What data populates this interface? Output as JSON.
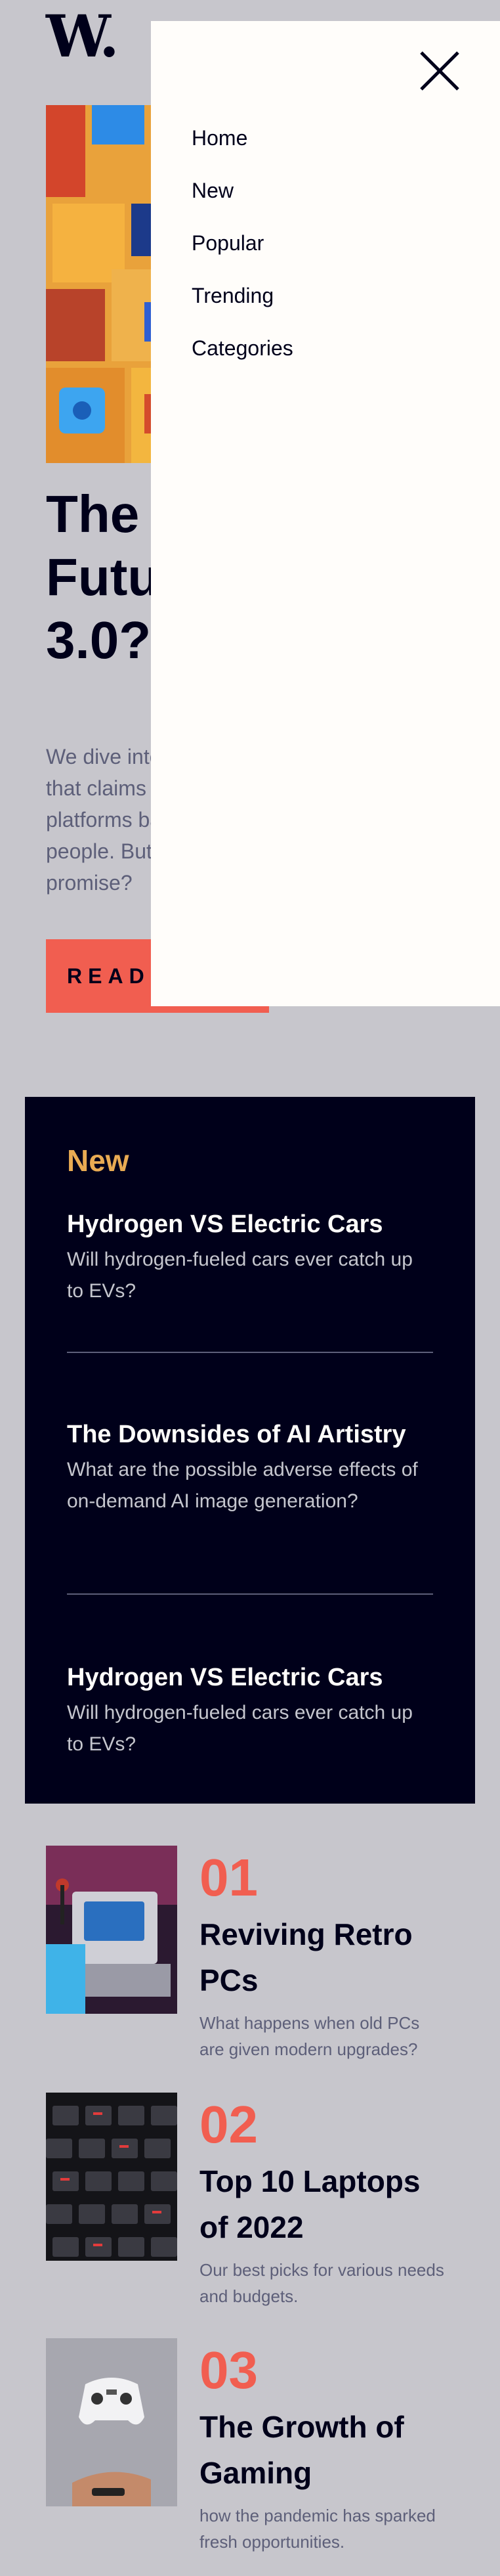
{
  "header": {
    "logo": "W."
  },
  "menu": {
    "items": [
      {
        "label": "Home"
      },
      {
        "label": "New"
      },
      {
        "label": "Popular"
      },
      {
        "label": "Trending"
      },
      {
        "label": "Categories"
      }
    ]
  },
  "hero": {
    "title": "The Bright Future of Web 3.0?",
    "text": "We dive into the next evolution of the web that claims to put the power of the platforms back into the hands of the people. But is it really fulfilling its promise?",
    "button_label": "READ MORE"
  },
  "new_section": {
    "heading": "New",
    "items": [
      {
        "title": "Hydrogen VS Electric Cars",
        "desc": "Will hydrogen-fueled cars ever catch up to EVs?"
      },
      {
        "title": "The Downsides of AI Artistry",
        "desc": "What are the possible adverse effects of on-demand AI image generation?"
      },
      {
        "title": "Hydrogen VS Electric Cars",
        "desc": "Will hydrogen-fueled cars ever catch up to EVs?"
      }
    ]
  },
  "ranked": [
    {
      "num": "01",
      "title": "Reviving Retro PCs",
      "desc": "What happens when old PCs are given modern upgrades?"
    },
    {
      "num": "02",
      "title": "Top 10 Laptops of 2022",
      "desc": "Our best picks for various needs and budgets."
    },
    {
      "num": "03",
      "title": "The Growth of Gaming",
      "desc": "how the pandemic has sparked fresh opportunities."
    }
  ],
  "colors": {
    "background": "#c7c6cc",
    "dark_navy": "#00001a",
    "accent_red": "#f15e50",
    "accent_orange": "#e9ab53",
    "off_white": "#fffdfa",
    "grayish_blue": "#5d5f79"
  }
}
